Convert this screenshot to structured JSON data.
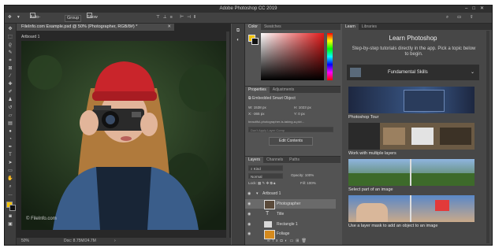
{
  "window": {
    "title": "Adobe Photoshop CC 2019",
    "controls": [
      "–",
      "□",
      "✕"
    ]
  },
  "options_bar": {
    "auto_select_label": "Auto-Select:",
    "auto_select_value": "Group",
    "show_transform_label": "Show Transform Controls"
  },
  "document": {
    "tab_label": "FileInfo.com Example.psd @ 50% (Photographer, RGB/8#) *",
    "artboard_label": "Artboard 1",
    "watermark": "© FileInfo.com",
    "zoom": "50%",
    "doc_size": "Doc: 8.75M/24.7M"
  },
  "color_panel": {
    "tabs": [
      "Color",
      "Swatches"
    ]
  },
  "properties_panel": {
    "tabs": [
      "Properties",
      "Adjustments"
    ],
    "object_type": "Embedded Smart Object",
    "w_label": "W:",
    "w_value": "1538 px",
    "h_label": "H:",
    "h_value": "1023 px",
    "x_label": "X:",
    "x_value": "-365 px",
    "y_label": "Y:",
    "y_value": "0 px",
    "filename": "beautiful-photographer-is-taking-a-pict...",
    "comps_placeholder": "Don't Apply Layer Comp",
    "edit_button": "Edit Contents"
  },
  "layers_panel": {
    "tabs": [
      "Layers",
      "Channels",
      "Paths"
    ],
    "filter": "Kind",
    "blend_mode": "Normal",
    "opacity_label": "Opacity:",
    "opacity_value": "100%",
    "lock_label": "Lock:",
    "fill_label": "Fill:",
    "fill_value": "100%",
    "layers": [
      {
        "name": "Artboard 1",
        "kind": "artboard",
        "selected": false
      },
      {
        "name": "Photographer",
        "kind": "image",
        "selected": true
      },
      {
        "name": "Title",
        "kind": "text",
        "selected": false
      },
      {
        "name": "Rectangle 1",
        "kind": "shape",
        "selected": false
      },
      {
        "name": "Foliage",
        "kind": "image",
        "selected": false
      }
    ],
    "footer_icons": [
      "link-icon",
      "fx-icon",
      "mask-icon",
      "adjustment-icon",
      "folder-icon",
      "new-layer-icon",
      "trash-icon"
    ]
  },
  "learn_panel": {
    "tabs": [
      "Learn",
      "Libraries"
    ],
    "heading": "Learn Photoshop",
    "subheading": "Step-by-step tutorials directly in the app. Pick a topic below to begin.",
    "section": "Fundamental Skills",
    "tutorials": [
      "Photoshop Tour",
      "Work with multiple layers",
      "Select part of an image",
      "Use a layer mask to add an object to an image"
    ]
  },
  "colors": {
    "accent": "#2d8ceb",
    "dark": "#323232",
    "panel": "#535353"
  }
}
